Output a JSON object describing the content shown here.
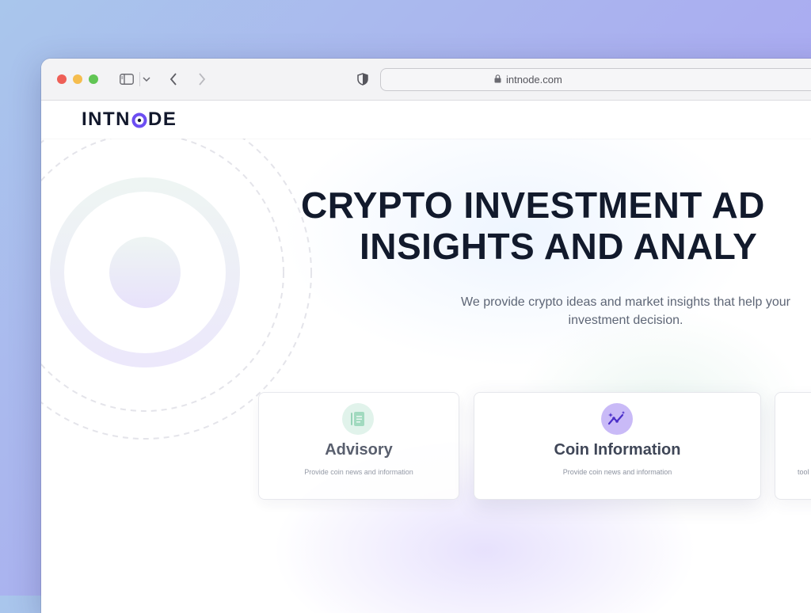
{
  "browser": {
    "url": "intnode.com"
  },
  "navbar": {
    "logo_text_left": "INTN",
    "logo_text_right": "DE"
  },
  "hero": {
    "headline_line1": "CRYPTO INVESTMENT AD",
    "headline_line2": "INSIGHTS AND ANALY",
    "subtitle": "We provide crypto ideas and market insights that help your\ninvestment decision."
  },
  "cards": [
    {
      "title": "Advisory",
      "description": "Provide coin news and information",
      "icon": "document-icon"
    },
    {
      "title": "Coin Information",
      "description": "Provide coin news and information",
      "icon": "chart-sparkle-icon"
    },
    {
      "title": "",
      "description": "tool",
      "icon": ""
    }
  ],
  "colors": {
    "brand_dark": "#12182c",
    "brand_accent": "#6c4ef2",
    "advisory_icon_bg": "#dff3ea",
    "coin_icon_bg": "#c9baf7"
  }
}
